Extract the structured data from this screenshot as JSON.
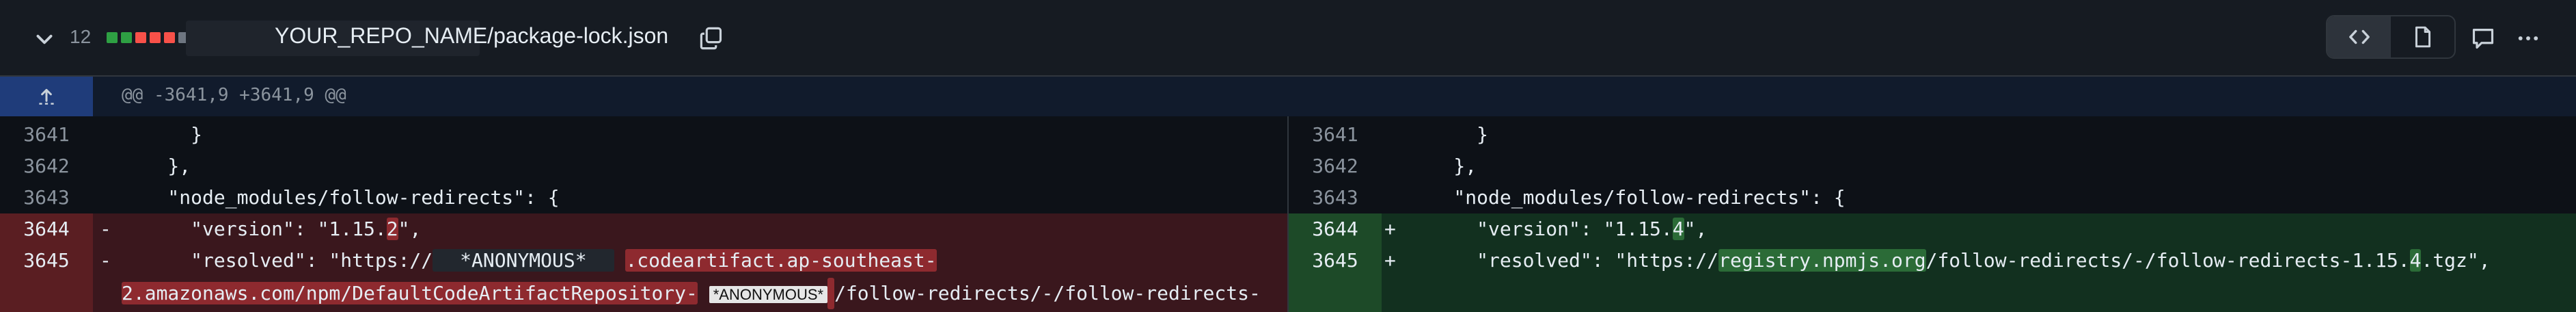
{
  "header": {
    "collapse_icon": "chevron-down-icon",
    "changed_lines": "12",
    "diffstat_colors": [
      "#2ea043",
      "#2ea043",
      "#f85149",
      "#f85149",
      "#f85149",
      "#6e7681"
    ],
    "file_path": "YOUR_REPO_NAME/package-lock.json",
    "copy_icon": "copy-icon",
    "view_code_icon": "code-icon",
    "view_file_icon": "file-icon",
    "comment_icon": "comment-icon",
    "more_icon": "kebab-horizontal-icon"
  },
  "hunk": {
    "expand_icon": "expand-up-icon",
    "header": "@@ -3641,9 +3641,9 @@"
  },
  "left": {
    "rows": [
      {
        "num": "3641",
        "code": "      }"
      },
      {
        "num": "3642",
        "code": "    },"
      },
      {
        "num": "3643",
        "code": "    \"node_modules/follow-redirects\": {"
      }
    ],
    "del1_num": "3644",
    "del1_sign": "-",
    "del1_pre": "      \"version\": \"1.15.",
    "del1_hl": "2",
    "del1_post": "\",",
    "del2_num": "3645",
    "del2_sign": "-",
    "del2_pre": "      \"resolved\": \"https://",
    "del2_redact": "*ANONYMOUS*",
    "del2_hl": ".codeartifact.ap-southeast-",
    "del2_line2_hl": "2.amazonaws.com/npm/DefaultCodeArtifactRepository-",
    "del2_line2_redact": "*ANONYMOUS*",
    "del2_line2_post": "/follow-redirects/-/follow-redirects-"
  },
  "right": {
    "rows": [
      {
        "num": "3641",
        "code": "      }"
      },
      {
        "num": "3642",
        "code": "    },"
      },
      {
        "num": "3643",
        "code": "    \"node_modules/follow-redirects\": {"
      }
    ],
    "add1_num": "3644",
    "add1_sign": "+",
    "add1_pre": "      \"version\": \"1.15.",
    "add1_hl": "4",
    "add1_post": "\",",
    "add2_num": "3645",
    "add2_sign": "+",
    "add2_pre": "      \"resolved\": \"https://",
    "add2_hl": "registry.npmjs.org",
    "add2_mid": "/follow-redirects/-/follow-redirects-1.15.",
    "add2_hl2": "4",
    "add2_post": ".tgz\","
  }
}
